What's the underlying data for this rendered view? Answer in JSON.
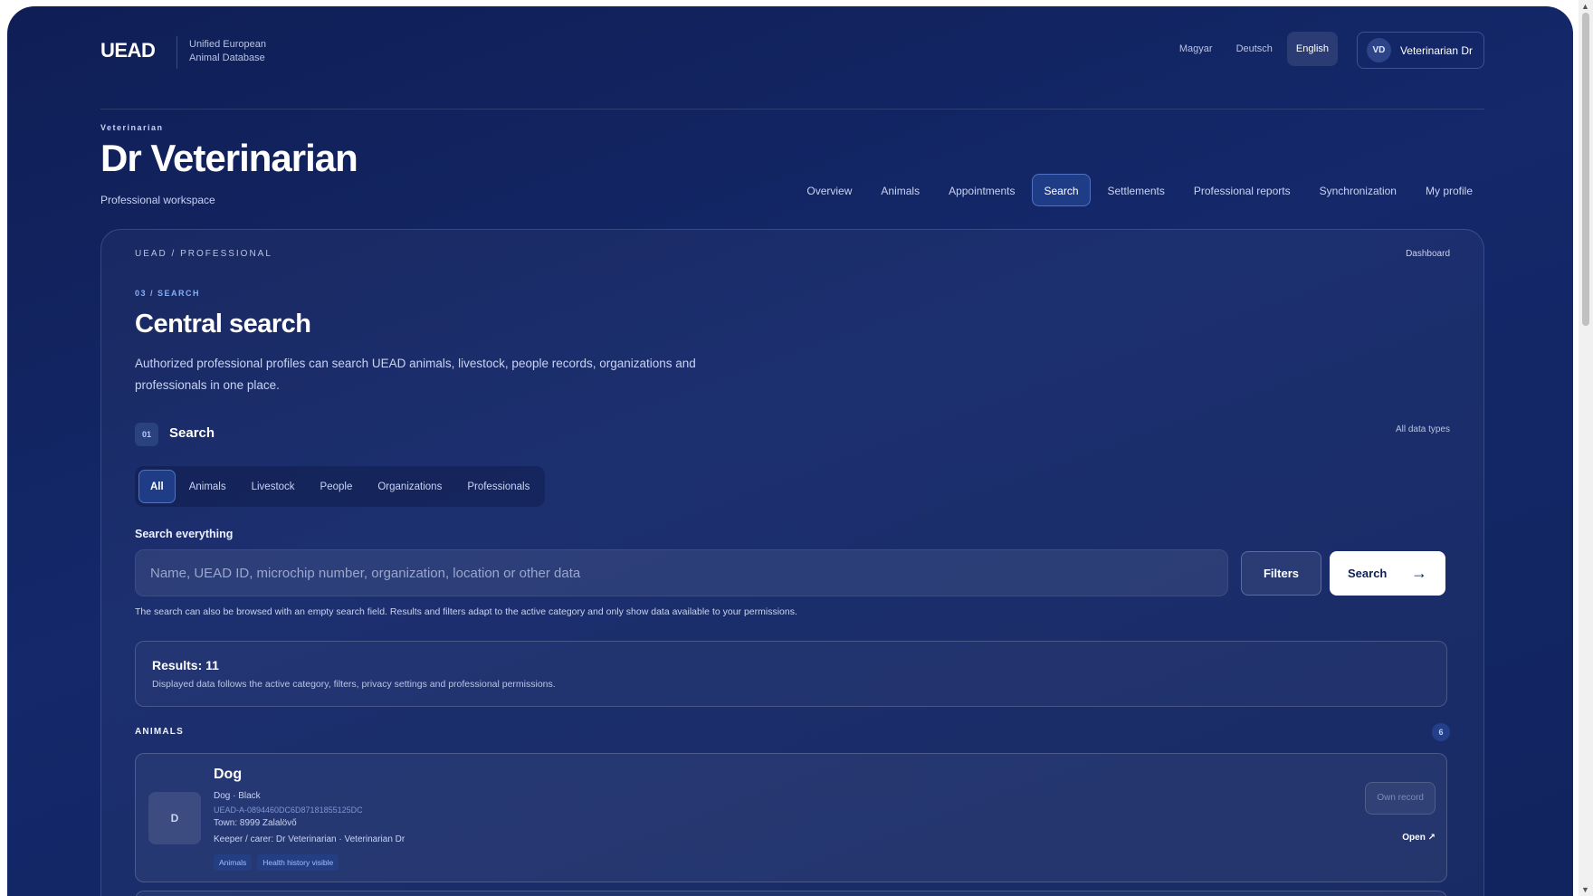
{
  "brand": {
    "logo": "UEAD",
    "tagline_line1": "Unified European",
    "tagline_line2": "Animal Database"
  },
  "languages": [
    {
      "label": "Magyar",
      "active": false
    },
    {
      "label": "Deutsch",
      "active": false
    },
    {
      "label": "English",
      "active": true
    }
  ],
  "user": {
    "initials": "VD",
    "name": "Veterinarian Dr"
  },
  "hero": {
    "role": "Veterinarian",
    "name": "Dr Veterinarian",
    "subtitle": "Professional workspace"
  },
  "nav": [
    {
      "label": "Overview",
      "active": false
    },
    {
      "label": "Animals",
      "active": false
    },
    {
      "label": "Appointments",
      "active": false
    },
    {
      "label": "Search",
      "active": true
    },
    {
      "label": "Settlements",
      "active": false
    },
    {
      "label": "Professional reports",
      "active": false
    },
    {
      "label": "Synchronization",
      "active": false
    },
    {
      "label": "My profile",
      "active": false
    }
  ],
  "panel": {
    "breadcrumb": "UEAD / PROFESSIONAL",
    "dashboard_link": "Dashboard",
    "step_tag": "03 / SEARCH",
    "title": "Central search",
    "description": "Authorized professional profiles can search UEAD animals, livestock, people records, organizations and professionals in one place."
  },
  "search_section": {
    "number": "01",
    "title": "Search",
    "scope": "All data types",
    "categories": [
      {
        "label": "All",
        "active": true
      },
      {
        "label": "Animals",
        "active": false
      },
      {
        "label": "Livestock",
        "active": false
      },
      {
        "label": "People",
        "active": false
      },
      {
        "label": "Organizations",
        "active": false
      },
      {
        "label": "Professionals",
        "active": false
      }
    ],
    "field_label": "Search everything",
    "placeholder": "Name, UEAD ID, microchip number, organization, location or other data",
    "value": "",
    "filters_label": "Filters",
    "search_label": "Search",
    "hint": "The search can also be browsed with an empty search field. Results and filters adapt to the active category and only show data available to your permissions."
  },
  "results": {
    "count_label": "Results: 11",
    "note": "Displayed data follows the active category, filters, privacy settings and professional permissions."
  },
  "groups": [
    {
      "label": "ANIMALS",
      "count": "6",
      "items": [
        {
          "initial": "D",
          "name": "Dog",
          "meta": "Dog · Black",
          "uead_id": "UEAD-A-0894460DC6D87181855125DC",
          "town": "Town: 8999 Zalalövő",
          "keeper": "Keeper / carer: Dr Veterinarian · Veterinarian Dr",
          "tags": [
            "Animals",
            "Health history visible"
          ],
          "badge": "Own record",
          "open_label": "Open ↗"
        }
      ]
    }
  ],
  "icons": {
    "search_arrow": "arrow-right-icon",
    "open_arrow": "external-link-icon"
  }
}
